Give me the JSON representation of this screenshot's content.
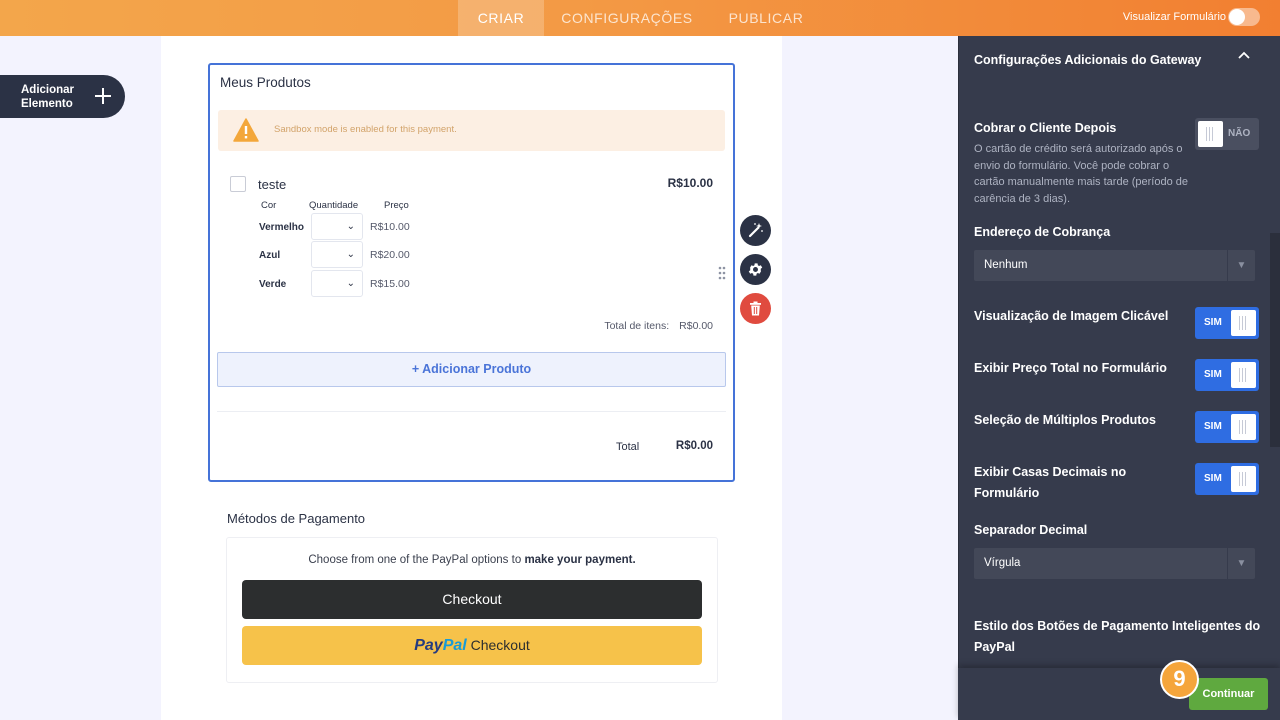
{
  "topbar": {
    "tabs": [
      {
        "label": "CRIAR",
        "active": true
      },
      {
        "label": "CONFIGURAÇÕES",
        "active": false
      },
      {
        "label": "PUBLICAR",
        "active": false
      }
    ],
    "preview_label": "Visualizar Formulário",
    "preview_toggle_on": false
  },
  "left": {
    "add_element_line1": "Adicionar",
    "add_element_line2": "Elemento"
  },
  "widget": {
    "title": "Meus Produtos",
    "sandbox_msg": "Sandbox mode is enabled for this payment.",
    "product_name": "teste",
    "product_price": "R$10.00",
    "options_headers": [
      "Cor",
      "Quantidade",
      "Preço"
    ],
    "options": [
      {
        "color": "Vermelho",
        "price": "R$10.00"
      },
      {
        "color": "Azul",
        "price": "R$20.00"
      },
      {
        "color": "Verde",
        "price": "R$15.00"
      }
    ],
    "total_items_label": "Total de itens:",
    "total_items_value": "R$0.00",
    "add_product_label": "+ Adicionar Produto",
    "total_label": "Total",
    "total_value": "R$0.00"
  },
  "payment": {
    "title": "Métodos de Pagamento",
    "desc_prefix": "Choose from one of the PayPal options to",
    "desc_bold": "make your payment.",
    "checkout_label": "Checkout",
    "paypal_logo_a": "Pay",
    "paypal_logo_b": "Pal",
    "paypal_checkout_label": "Checkout"
  },
  "panel": {
    "section_title": "Configurações Adicionais do Gateway",
    "charge_later_label": "Cobrar o Cliente Depois",
    "charge_later_desc": "O cartão de crédito será autorizado após o envio do formulário. Você pode cobrar o cartão manualmente mais tarde (período de carência de 3 dias).",
    "charge_later_toggle": "NÃO",
    "billing_label": "Endereço de Cobrança",
    "billing_value": "Nenhum",
    "image_preview_label": "Visualização de Imagem Clicável",
    "show_total_label": "Exibir Preço Total no Formulário",
    "multi_select_label": "Seleção de Múltiplos Produtos",
    "decimals_label_1": "Exibir Casas Decimais no",
    "decimals_label_2": "Formulário",
    "on_label": "SIM",
    "decimal_sep_label": "Separador Decimal",
    "decimal_sep_value": "Vírgula",
    "smart_buttons_label_1": "Estilo dos Botões de Pagamento Inteligentes do",
    "smart_buttons_label_2": "PayPal",
    "continue_label": "Continuar",
    "step_badge": "9"
  },
  "colors": {
    "accent_orange": "#f39a45",
    "widget_border": "#4573d8",
    "panel_bg": "#363b4c",
    "toggle_on": "#2f6de2",
    "continue_green": "#5fa93f",
    "delete_red": "#e04b3f"
  }
}
